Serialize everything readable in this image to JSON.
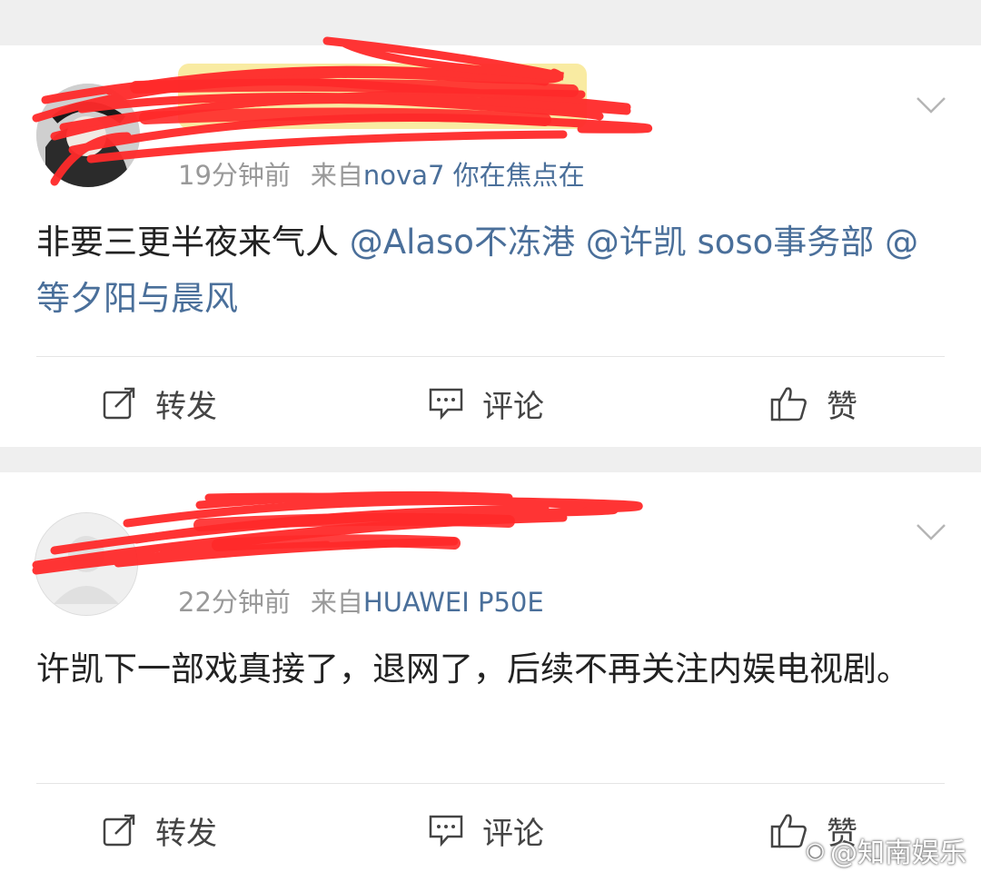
{
  "posts": [
    {
      "author_name": "",
      "timestamp": "19分钟前",
      "source_prefix": "来自",
      "device": "nova7 你在焦点在",
      "text_plain": "非要三更半夜来气人",
      "mentions": [
        "@Alaso不冻港",
        "@许凯 soso事务部",
        "@等夕阳与晨风"
      ],
      "actions": {
        "repost": "转发",
        "comment": "评论",
        "like": "赞"
      }
    },
    {
      "author_name": "",
      "timestamp": "22分钟前",
      "source_prefix": "来自",
      "device": "HUAWEI P50E",
      "text": "许凯下一部戏真接了，退网了，后续不再关注内娱电视剧。",
      "actions": {
        "repost": "转发",
        "comment": "评论",
        "like": "赞"
      }
    }
  ],
  "watermark": {
    "platform_icon": "weibo-icon",
    "text": "@知南娱乐"
  },
  "colors": {
    "link": "#4a6f9a",
    "meta": "#999999",
    "redaction": "#ff2a2a",
    "highlight": "#f7e37a",
    "background": "#efefef"
  },
  "icons": [
    "chevron-down-icon",
    "repost-icon",
    "comment-icon",
    "like-icon",
    "avatar-placeholder-icon"
  ]
}
